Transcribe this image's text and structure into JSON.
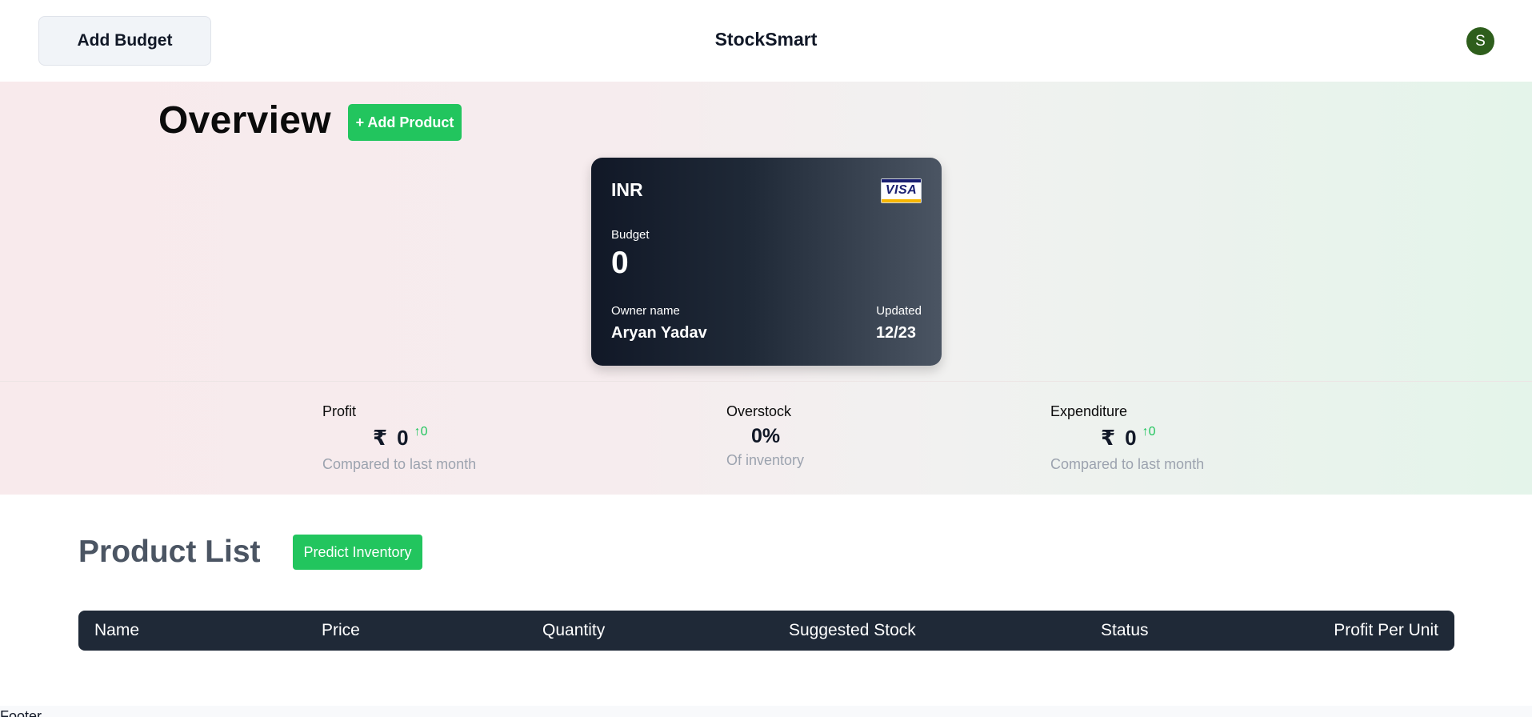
{
  "header": {
    "add_budget_label": "Add Budget",
    "brand": "StockSmart",
    "avatar_initial": "S",
    "avatar_color": "#2e5e1c"
  },
  "overview": {
    "title": "Overview",
    "add_product_label": "+ Add Product"
  },
  "card": {
    "currency": "INR",
    "brand_logo": "VISA",
    "budget_label": "Budget",
    "budget_value": "0",
    "owner_label": "Owner name",
    "owner_name": "Aryan Yadav",
    "updated_label": "Updated",
    "updated_value": "12/23"
  },
  "stats": {
    "profit": {
      "label": "Profit",
      "currency_symbol": "₹",
      "value": "0",
      "delta_arrow": "↑",
      "delta": "0",
      "sub": "Compared to last month"
    },
    "overstock": {
      "label": "Overstock",
      "value": "0%",
      "sub": "Of inventory"
    },
    "expenditure": {
      "label": "Expenditure",
      "currency_symbol": "₹",
      "value": "0",
      "delta_arrow": "↑",
      "delta": "0",
      "sub": "Compared to last month"
    }
  },
  "products": {
    "title": "Product List",
    "predict_label": "Predict Inventory",
    "columns": [
      "Name",
      "Price",
      "Quantity",
      "Suggested Stock",
      "Status",
      "Profit Per Unit"
    ]
  },
  "footer": {
    "text": "Footer"
  },
  "colors": {
    "accent_green": "#22c55e",
    "dark_navy": "#1f2937"
  }
}
